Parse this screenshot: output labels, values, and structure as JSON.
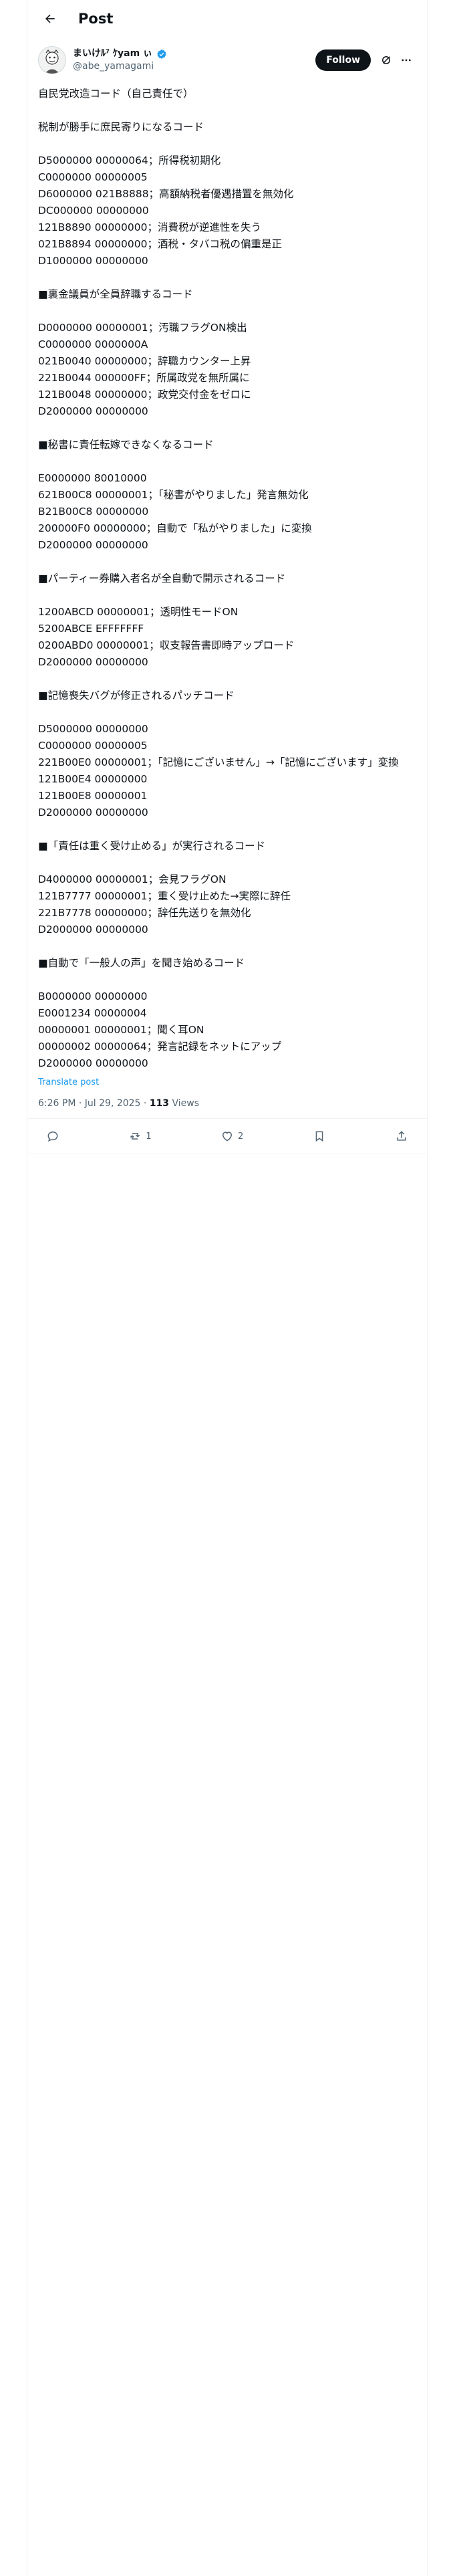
{
  "topbar": {
    "title": "Post"
  },
  "author": {
    "display_name": "まいけﾙ⁷ ｹyam ぃ",
    "handle": "@abe_yamagami"
  },
  "follow_label": "Follow",
  "post": {
    "lines": [
      "自民党改造コード（自己責任で）",
      "",
      "税制が勝手に庶民寄りになるコード",
      "",
      "D5000000 00000064；所得税初期化",
      "C0000000 00000005",
      "D6000000 021B8888；高額納税者優遇措置を無効化",
      "DC000000 00000000",
      "121B8890 00000000；消費税が逆進性を失う",
      "021B8894 00000000；酒税・タバコ税の偏重是正",
      "D1000000 00000000",
      "",
      "■裏金議員が全員辞職するコード",
      "",
      "D0000000 00000001；汚職フラグON検出",
      "C0000000 0000000A",
      "021B0040 00000000；辞職カウンター上昇",
      "221B0044 000000FF；所属政党を無所属に",
      "121B0048 00000000；政党交付金をゼロに",
      "D2000000 00000000",
      "",
      "■秘書に責任転嫁できなくなるコード",
      "",
      "E0000000 80010000",
      "621B00C8 00000001；「秘書がやりました」発言無効化",
      "B21B00C8 00000000",
      "200000F0 00000000；自動で「私がやりました」に変換",
      "D2000000 00000000",
      "",
      "■パーティー券購入者名が全自動で開示されるコード",
      "",
      "1200ABCD 00000001；透明性モードON",
      "5200ABCE EFFFFFFF",
      "0200ABD0 00000001；収支報告書即時アップロード",
      "D2000000 00000000",
      "",
      "■記憶喪失バグが修正されるパッチコード",
      "",
      "D5000000 00000000",
      "C0000000 00000005",
      "221B00E0 00000001；「記憶にございません」→「記憶にございます」変換",
      "121B00E4 00000000",
      "121B00E8 00000001",
      "D2000000 00000000",
      "",
      "■「責任は重く受け止める」が実行されるコード",
      "",
      "D4000000 00000001；会見フラグON",
      "121B7777 00000001；重く受け止めた→実際に辞任",
      "221B7778 00000000；辞任先送りを無効化",
      "D2000000 00000000",
      "",
      "■自動で「一般人の声」を聞き始めるコード",
      "",
      "B0000000 00000000",
      "E0001234 00000004",
      "00000001 00000001；聞く耳ON",
      "00000002 00000064；発言記録をネットにアップ",
      "D2000000 00000000"
    ],
    "translate_label": "Translate post",
    "time": "6:26 PM",
    "date": "Jul 29, 2025",
    "views_count": "113",
    "views_label": "Views"
  },
  "actions": {
    "retweets": "1",
    "likes": "2"
  }
}
